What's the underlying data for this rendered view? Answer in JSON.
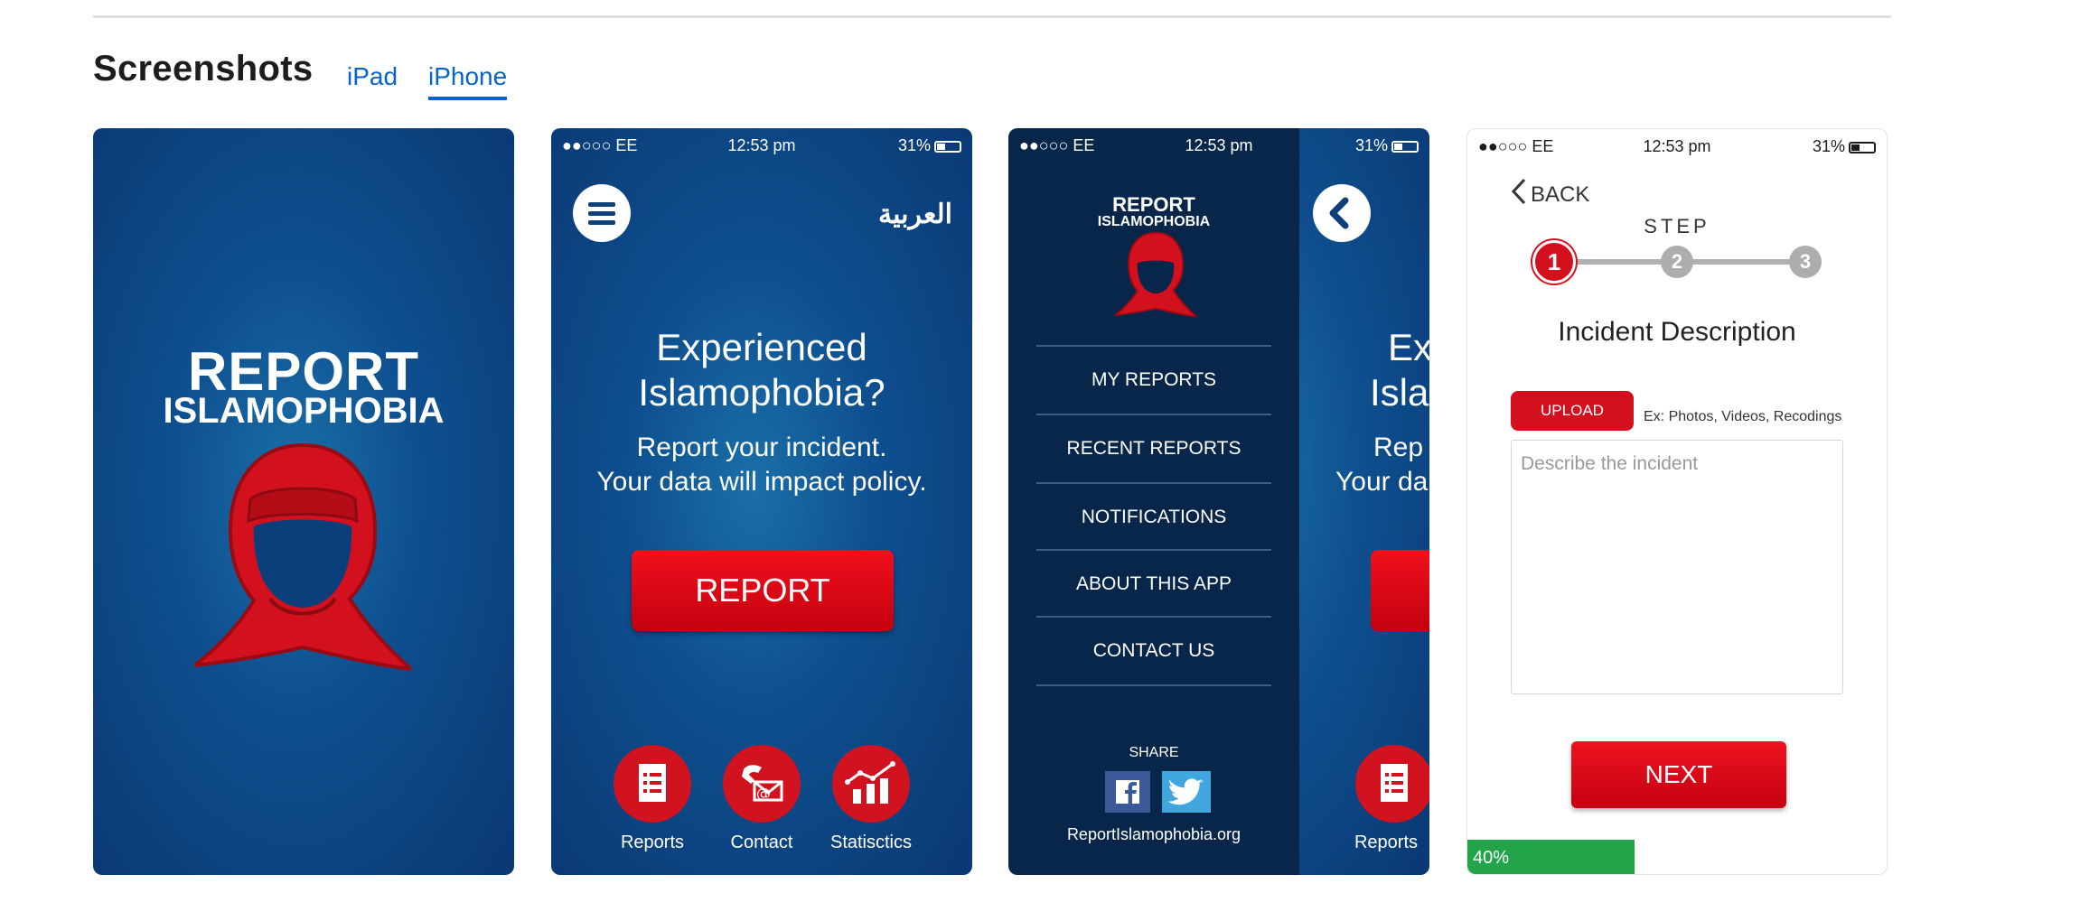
{
  "section": {
    "title": "Screenshots",
    "tabs": [
      {
        "label": "iPad",
        "selected": false
      },
      {
        "label": "iPhone",
        "selected": true
      }
    ]
  },
  "status_bar": {
    "carrier": "●●○○○ EE",
    "time": "12:53 pm",
    "battery": "31%"
  },
  "shot1": {
    "brand_line1": "REPORT",
    "brand_line2": "ISLAMOPHOBIA"
  },
  "shot2": {
    "language": "العربية",
    "headline_line1": "Experienced",
    "headline_line2": "Islamophobia?",
    "sub_line1": "Report your incident.",
    "sub_line2": "Your data will impact policy.",
    "report_button": "REPORT",
    "footer": [
      {
        "label": "Reports"
      },
      {
        "label": "Contact"
      },
      {
        "label": "Statisctics"
      }
    ]
  },
  "shot3": {
    "brand_line1": "REPORT",
    "brand_line2": "ISLAMOPHOBIA",
    "menu": [
      "MY REPORTS",
      "RECENT REPORTS",
      "NOTIFICATIONS",
      "ABOUT THIS APP",
      "CONTACT US"
    ],
    "share_label": "SHARE",
    "website": "ReportIslamophobia.org",
    "peek_headline_line1": "Ex",
    "peek_headline_line2": "Isla",
    "peek_sub_line1": "Rep",
    "peek_sub_line2": "Your da",
    "peek_footer_label": "Reports"
  },
  "shot4": {
    "back_label": "BACK",
    "step_label": "STEP",
    "steps": [
      "1",
      "2",
      "3"
    ],
    "current_step": 1,
    "title": "Incident Description",
    "upload_button": "UPLOAD",
    "upload_hint": "Ex: Photos, Videos, Recodings",
    "description_placeholder": "Describe the incident",
    "next_button": "NEXT",
    "progress": "40%"
  },
  "colors": {
    "link": "#0a63c7",
    "app_blue": "#0e4f8f",
    "app_red": "#d3101d",
    "progress_green": "#22a44a"
  }
}
